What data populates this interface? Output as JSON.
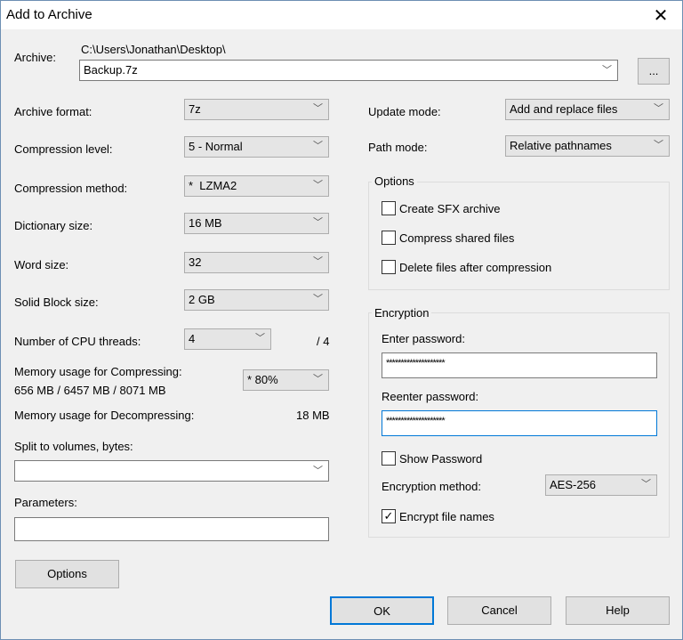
{
  "window": {
    "title": "Add to Archive",
    "close": "✕"
  },
  "archive": {
    "label": "Archive:",
    "path": "C:\\Users\\Jonathan\\Desktop\\",
    "name": "Backup.7z",
    "browse": "..."
  },
  "left": {
    "format": {
      "label": "Archive format:",
      "value": "7z"
    },
    "level": {
      "label": "Compression level:",
      "value": "5 - Normal"
    },
    "method": {
      "label": "Compression method:",
      "value": "*  LZMA2"
    },
    "dict": {
      "label": "Dictionary size:",
      "value": "16 MB"
    },
    "word": {
      "label": "Word size:",
      "value": "32"
    },
    "solid": {
      "label": "Solid Block size:",
      "value": "2 GB"
    },
    "threads": {
      "label": "Number of CPU threads:",
      "value": "4",
      "max": "/ 4"
    },
    "memc": {
      "label": "Memory usage for Compressing:",
      "detail": "656 MB / 6457 MB / 8071 MB",
      "value": "* 80%"
    },
    "memd": {
      "label": "Memory usage for Decompressing:",
      "value": "18 MB"
    },
    "split": {
      "label": "Split to volumes, bytes:",
      "value": ""
    },
    "params": {
      "label": "Parameters:",
      "value": ""
    },
    "options_btn": "Options"
  },
  "right": {
    "update": {
      "label": "Update mode:",
      "value": "Add and replace files"
    },
    "pathmode": {
      "label": "Path mode:",
      "value": "Relative pathnames"
    },
    "options": {
      "title": "Options",
      "sfx": "Create SFX archive",
      "shared": "Compress shared files",
      "delete": "Delete files after compression"
    },
    "enc": {
      "title": "Encryption",
      "enter": "Enter password:",
      "pw1": "********************",
      "reenter": "Reenter password:",
      "pw2": "********************",
      "show": "Show Password",
      "method_label": "Encryption method:",
      "method": "AES-256",
      "names": "Encrypt file names",
      "check": "✓"
    }
  },
  "buttons": {
    "ok": "OK",
    "cancel": "Cancel",
    "help": "Help"
  },
  "chev": "﹀"
}
